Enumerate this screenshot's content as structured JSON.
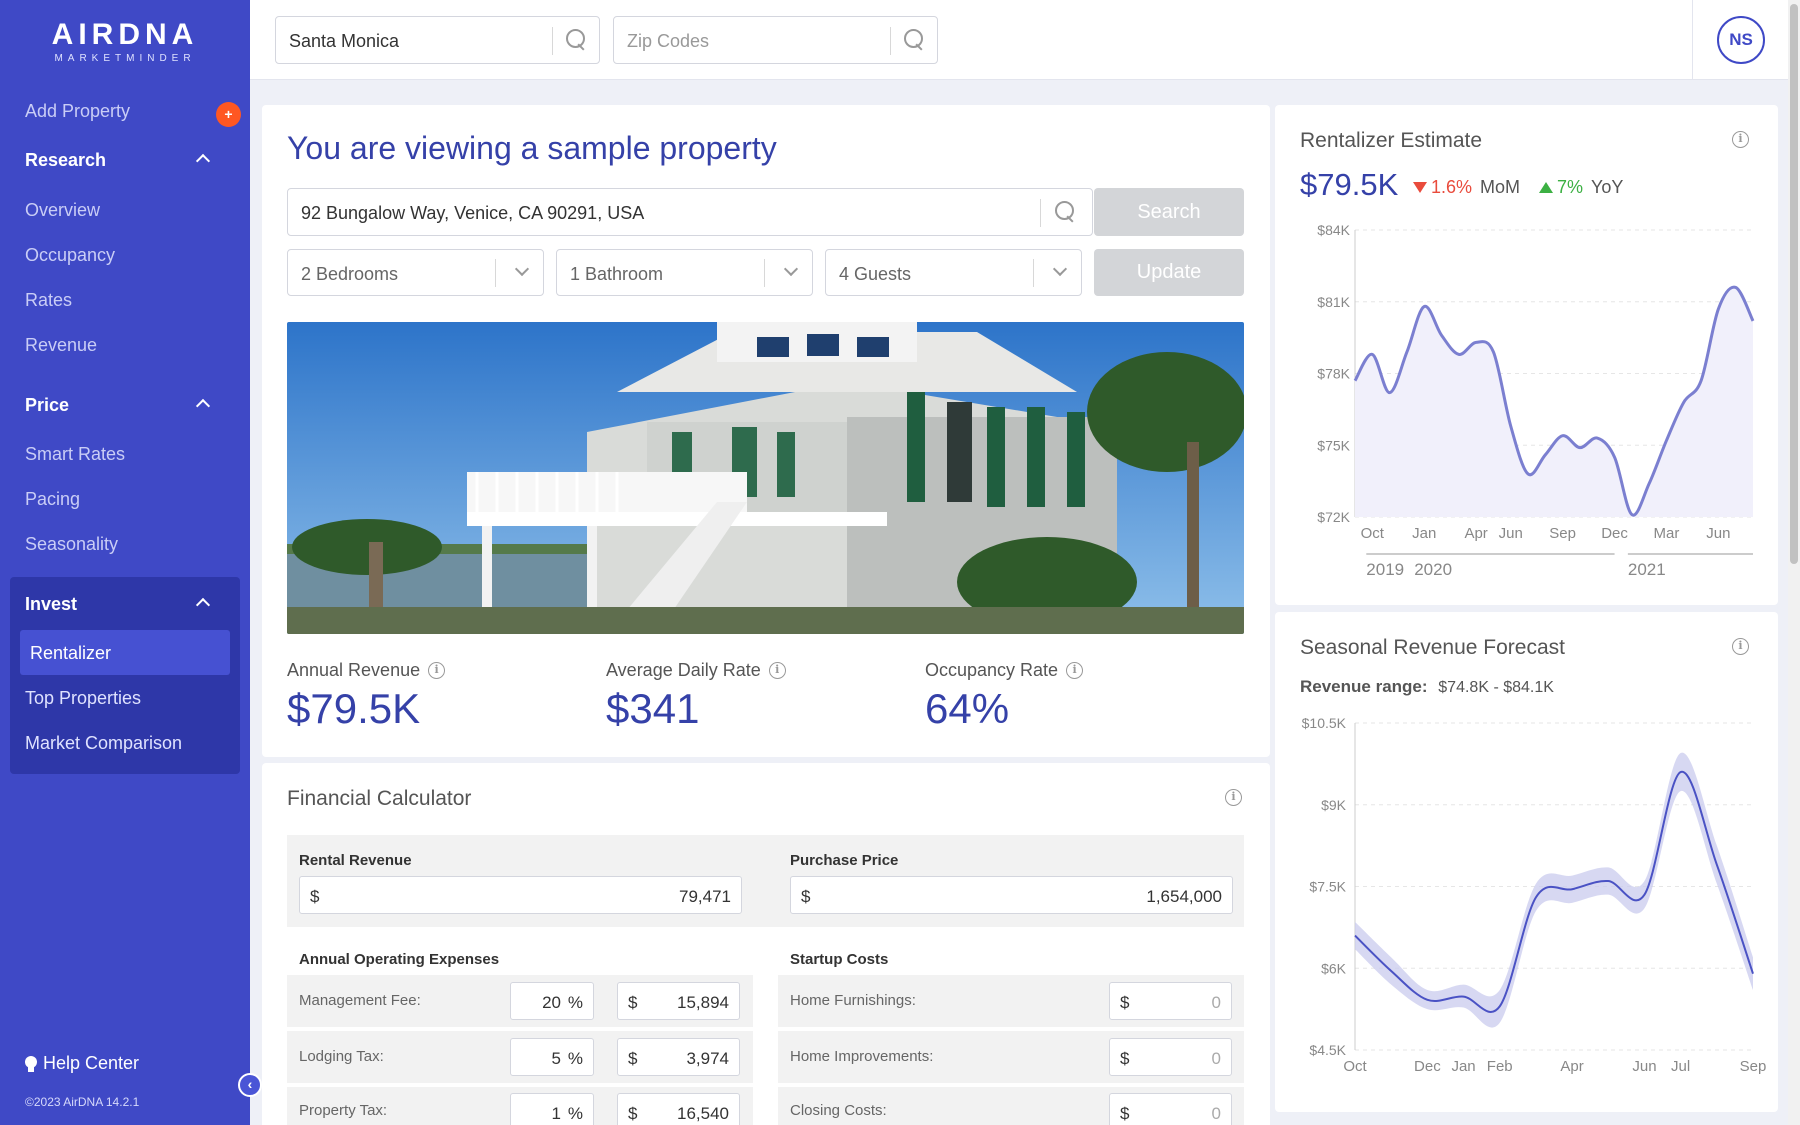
{
  "brand": {
    "name": "AIRDNA",
    "sub": "MARKETMINDER",
    "copyright": "©2023 AirDNA 14.2.1"
  },
  "sidebar": {
    "add_property": "Add Property",
    "add_badge": "+",
    "research": {
      "label": "Research",
      "items": [
        "Overview",
        "Occupancy",
        "Rates",
        "Revenue"
      ]
    },
    "price": {
      "label": "Price",
      "items": [
        "Smart Rates",
        "Pacing",
        "Seasonality"
      ]
    },
    "invest": {
      "label": "Invest",
      "items": [
        "Rentalizer",
        "Top Properties",
        "Market Comparison"
      ],
      "active": "Rentalizer"
    },
    "help": "Help Center",
    "collapse": "‹"
  },
  "topbar": {
    "market_search": {
      "value": "Santa Monica"
    },
    "zip_search": {
      "placeholder": "Zip Codes"
    },
    "avatar": "NS"
  },
  "main": {
    "title": "You are viewing a sample property",
    "address": "92 Bungalow Way, Venice, CA 90291, USA",
    "search_button": "Search",
    "update_button": "Update",
    "bedrooms": "2 Bedrooms",
    "bathrooms": "1 Bathroom",
    "guests": "4 Guests",
    "metrics": [
      {
        "label": "Annual Revenue",
        "value": "$79.5K"
      },
      {
        "label": "Average Daily Rate",
        "value": "$341"
      },
      {
        "label": "Occupancy Rate",
        "value": "64%"
      }
    ]
  },
  "financial": {
    "title": "Financial Calculator",
    "rental_revenue": {
      "label": "Rental Revenue",
      "prefix": "$",
      "value": "79,471"
    },
    "purchase_price": {
      "label": "Purchase Price",
      "prefix": "$",
      "value": "1,654,000"
    },
    "operating_title": "Annual Operating Expenses",
    "startup_title": "Startup Costs",
    "expenses": [
      {
        "label": "Management Fee:",
        "pct": "20",
        "amount": "15,894"
      },
      {
        "label": "Lodging Tax:",
        "pct": "5",
        "amount": "3,974"
      },
      {
        "label": "Property Tax:",
        "pct": "1",
        "amount": "16,540"
      }
    ],
    "startup": [
      {
        "label": "Home Furnishings:",
        "value": "0"
      },
      {
        "label": "Home Improvements:",
        "value": "0"
      },
      {
        "label": "Closing Costs:",
        "value": "0"
      }
    ],
    "pct_symbol": "%",
    "currency_symbol": "$"
  },
  "estimate": {
    "title": "Rentalizer Estimate",
    "value": "$79.5K",
    "mom": {
      "value": "1.6%",
      "label": "MoM",
      "direction": "down",
      "color": "#e94b3c"
    },
    "yoy": {
      "value": "7%",
      "label": "YoY",
      "direction": "up",
      "color": "#3cb043"
    }
  },
  "forecast": {
    "title": "Seasonal Revenue Forecast",
    "range_label": "Revenue range:",
    "range_value": "$74.8K - $84.1K"
  },
  "colors": {
    "accent": "#3f49c6",
    "title_blue": "#3541a8",
    "line": "#7b7fd0",
    "area": "#f1f0fb"
  },
  "chart_data": [
    {
      "type": "area",
      "title": "Rentalizer Estimate",
      "y_ticks": [
        "$84K",
        "$81K",
        "$78K",
        "$75K",
        "$72K"
      ],
      "ylim": [
        72000,
        84000
      ],
      "x_tick_labels": [
        "Oct",
        "Jan",
        "Apr",
        "Jun",
        "Sep",
        "Dec",
        "Mar",
        "Jun"
      ],
      "year_labels": [
        "2019",
        "2020",
        "2021"
      ],
      "x": [
        "2019-09",
        "2019-10",
        "2019-11",
        "2019-12",
        "2020-01",
        "2020-02",
        "2020-03",
        "2020-04",
        "2020-05",
        "2020-06",
        "2020-07",
        "2020-08",
        "2020-09",
        "2020-10",
        "2020-11",
        "2020-12",
        "2021-01",
        "2021-02",
        "2021-03",
        "2021-04",
        "2021-05",
        "2021-06",
        "2021-07",
        "2021-08"
      ],
      "values": [
        77700,
        78800,
        77200,
        78900,
        80800,
        79600,
        78800,
        79300,
        78900,
        75800,
        73800,
        74600,
        75400,
        74900,
        75300,
        74500,
        72100,
        73400,
        75200,
        76800,
        77700,
        80700,
        81600,
        80200
      ]
    },
    {
      "type": "line",
      "title": "Seasonal Revenue Forecast",
      "y_ticks": [
        "$10.5K",
        "$9K",
        "$7.5K",
        "$6K",
        "$4.5K"
      ],
      "ylim": [
        4500,
        10500
      ],
      "x_tick_labels": [
        "Oct",
        "Dec",
        "Jan",
        "Feb",
        "Apr",
        "Jun",
        "Jul",
        "Sep"
      ],
      "x": [
        "Oct",
        "Nov",
        "Dec",
        "Jan",
        "Feb",
        "Mar",
        "Apr",
        "May",
        "Jun",
        "Jul",
        "Aug",
        "Sep"
      ],
      "values": [
        6600,
        5950,
        5420,
        5480,
        5300,
        7300,
        7450,
        7600,
        7350,
        9600,
        7900,
        5900
      ],
      "band_upper": [
        6850,
        6200,
        5600,
        5700,
        5600,
        7550,
        7700,
        7850,
        7600,
        9950,
        8250,
        6200
      ],
      "band_lower": [
        6350,
        5700,
        5250,
        5280,
        5000,
        7050,
        7200,
        7350,
        7100,
        9250,
        7550,
        5600
      ]
    }
  ]
}
